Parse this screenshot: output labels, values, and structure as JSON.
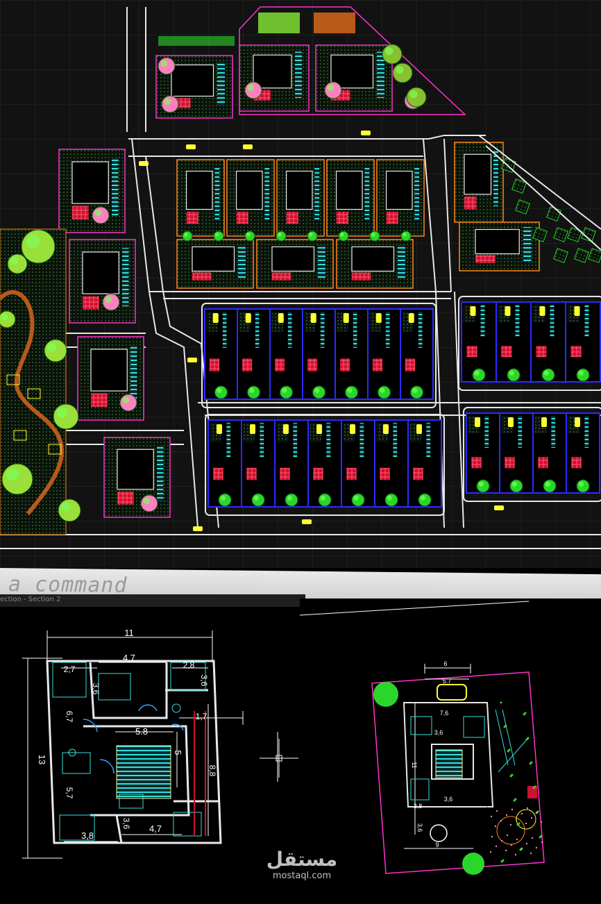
{
  "command_line": {
    "prompt": "a command"
  },
  "layout_tabs": {
    "label": "ection - Section 2"
  },
  "floor_plan": {
    "dimensions": {
      "total_width": "11",
      "total_height": "13",
      "top_room_width": "4,7",
      "top_left_room": "2,7",
      "top_right_room": "2,8",
      "bedroom_height": "3,6",
      "right_room_height": "3,6",
      "left_room_height": "6,7",
      "hall_width": "5.8",
      "terrace_width": "1,7",
      "hall_height": "5",
      "side_strip": "8,8",
      "bottom_left_height": "5,7",
      "bottom_mid_height": "3,6",
      "bottom_right_width": "4,7",
      "bottom_left_width": "3,8"
    }
  },
  "landscape_plan": {
    "dimensions": {
      "top_width": "6",
      "inner_width": "5.7",
      "room_a": "7,6",
      "room_b": "3,6",
      "room_c": "3,6",
      "room_d": "3,8",
      "side_height": "11",
      "bottom_width": "9",
      "left_lower": "3,6"
    }
  },
  "watermark": {
    "arabic": "مستقل",
    "latin": "mostaql.com"
  },
  "colors": {
    "canvas": "#121212",
    "grid": "#2a2a2a",
    "road": "#e8e8e8",
    "magenta_plot": "#ff33cc",
    "orange_plot": "#ff8a1a",
    "blue_plot": "#2b2bff",
    "cyan": "#33e0e0",
    "green_tree": "#2bd62b",
    "yellow_car": "#ffff33",
    "red_hatch": "#d01030"
  }
}
